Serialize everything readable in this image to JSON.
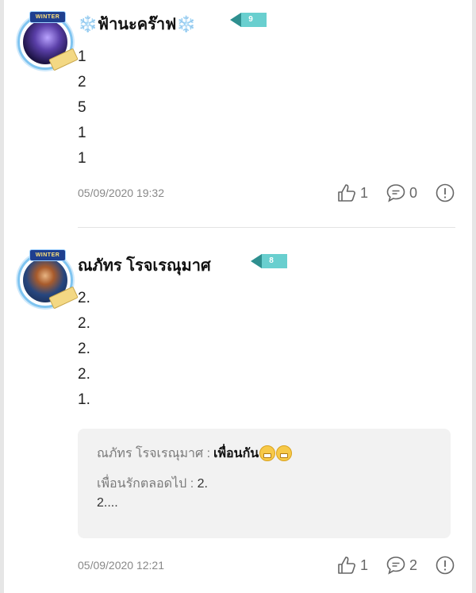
{
  "comments": [
    {
      "name": "ฟ้านะคร๊าฟ",
      "name_prefix": "❄️",
      "name_suffix": "❄️",
      "level": "9",
      "lines": [
        "1",
        "2",
        "5",
        "1",
        "1"
      ],
      "timestamp": "05/09/2020 19:32",
      "likes": "1",
      "replies": "0"
    },
    {
      "name": "ณภัทร โรจเรณุมาศ",
      "level": "8",
      "lines": [
        "2.",
        "2.",
        "2.",
        "2.",
        "1."
      ],
      "quote": {
        "author1": "ณภัทร โรจเรณุมาศ :",
        "text1": "เพื่อนกัน",
        "author2": "เพื่อนรักตลอดไป :",
        "text2_line1": "2.",
        "text2_line2": "2...."
      },
      "timestamp": "05/09/2020 12:21",
      "likes": "1",
      "replies": "2"
    }
  ],
  "icons": {
    "like": "thumbs-up-icon",
    "reply": "comment-bubble-icon",
    "report": "report-icon",
    "snowflake": "snowflake-icon",
    "emoji": "grinning-face-icon"
  },
  "colors": {
    "level_badge": "#69cfcf",
    "avatar_frame": "#7fc4f0",
    "quote_bg": "#f2f2f2"
  }
}
